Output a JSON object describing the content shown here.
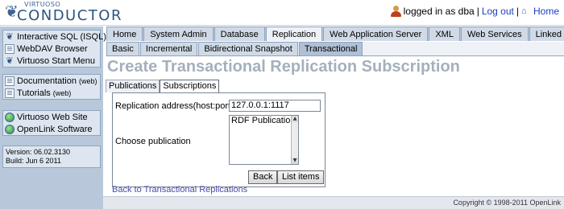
{
  "brand": {
    "top": "VIRTUOSO",
    "main": "CONDUCTOR"
  },
  "user": {
    "logged_in_text": "logged in as dba",
    "separator": "|",
    "logout": "Log out",
    "home": "Home"
  },
  "sidebar": {
    "group1": [
      "Interactive SQL (ISQL)",
      "WebDAV Browser",
      "Virtuoso Start Menu"
    ],
    "group2": [
      {
        "label": "Documentation",
        "suffix": "(web)"
      },
      {
        "label": "Tutorials",
        "suffix": "(web)"
      }
    ],
    "group3": [
      "Virtuoso Web Site",
      "OpenLink Software"
    ],
    "version": "Version: 06.02.3130",
    "build": "Build: Jun 6 2011"
  },
  "main_tabs": [
    "Home",
    "System Admin",
    "Database",
    "Replication",
    "Web Application Server",
    "XML",
    "Web Services",
    "Linked Data"
  ],
  "main_tabs_active": "Replication",
  "sub_tabs": [
    "Basic",
    "Incremental",
    "Bidirectional Snapshot",
    "Transactional"
  ],
  "sub_tabs_active": "Transactional",
  "page_title": "Create Transactional Replication Subscription",
  "content_tabs": [
    "Publications",
    "Subscriptions"
  ],
  "content_tabs_active": "Subscriptions",
  "form": {
    "address_label": "Replication address(host:port)",
    "address_value": "127.0.0.1:1117",
    "publication_label": "Choose publication",
    "publication_options": [
      "RDF Publication"
    ],
    "back_button": "Back",
    "list_button": "List items"
  },
  "back_link": "Back to Transactional Replications",
  "footer": {
    "copyright": "Copyright © 1998-2011 OpenLink"
  }
}
